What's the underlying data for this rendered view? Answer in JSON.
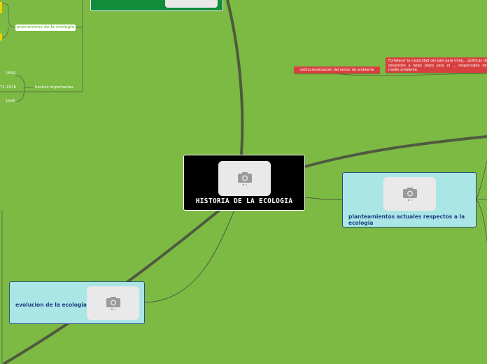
{
  "central": {
    "title": "HISTORIA DE LA ECOLOGIA"
  },
  "nodes": {
    "right_main": {
      "label": "planteamientos actuales respectos a la ecologia"
    },
    "left_main": {
      "label": "evolucion de la ecologia"
    }
  },
  "topics": {
    "institucionalizacion": "nstitucionalización del sector de ambiente",
    "fortalecer": "Fortalecer la capacidad del país para integ... políticas de desarrollo a largo plazo para el ... responsable del medio ambiente.",
    "precursores": "precursores de la ecologia",
    "hechos": "hechos importantes",
    "year_1859": "1859",
    "year_1971": "71-1976",
    "year_1935": "1935"
  },
  "icons": {
    "image_placeholder": "camera-icon"
  },
  "colors": {
    "background": "#7cba44",
    "central": "#000000",
    "main_topic_fill": "#abe6e6",
    "main_topic_text": "#1b3f85",
    "red_topic": "#d84040",
    "top_node": "#118c3a",
    "connector": "#4f5a3f"
  }
}
